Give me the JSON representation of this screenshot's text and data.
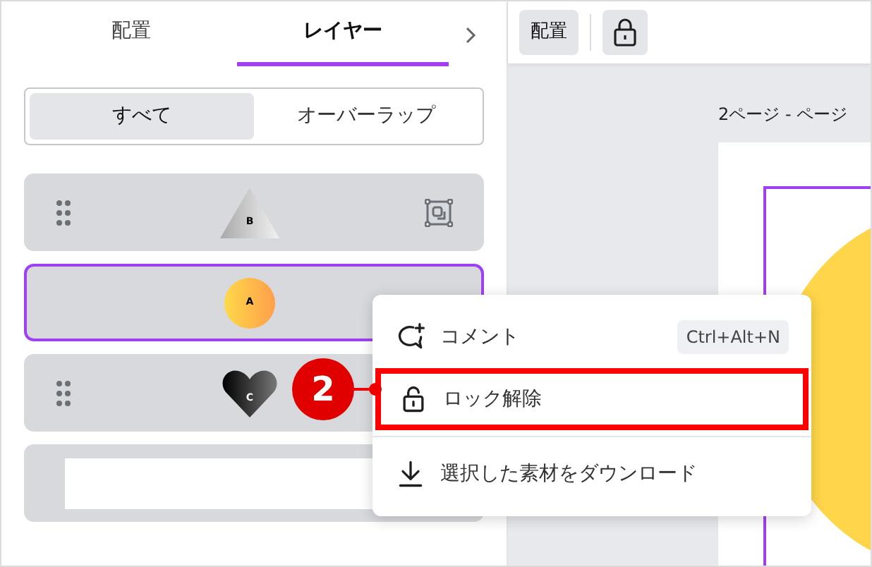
{
  "tabs": [
    {
      "label": "配置",
      "selected": false
    },
    {
      "label": "レイヤー",
      "selected": true
    }
  ],
  "filter": [
    {
      "label": "すべて",
      "selected": true
    },
    {
      "label": "オーバーラップ",
      "selected": false
    }
  ],
  "layers": [
    {
      "kind": "triangle",
      "letter": "B",
      "selected": false,
      "handle": true,
      "frame_icon": true
    },
    {
      "kind": "circle",
      "letter": "A",
      "selected": true,
      "handle": false,
      "frame_icon": false
    },
    {
      "kind": "heart",
      "letter": "C",
      "selected": false,
      "handle": true,
      "frame_icon": false
    },
    {
      "kind": "rect",
      "selected": false,
      "handle": false,
      "frame_icon": false
    }
  ],
  "toolbar": {
    "arrange_label": "配置"
  },
  "canvas": {
    "page_title": "2ページ - ページ"
  },
  "context_menu": [
    {
      "kind": "comment",
      "label": "コメント",
      "shortcut": "Ctrl+Alt+N",
      "highlighted": false
    },
    {
      "kind": "unlock",
      "label": "ロック解除",
      "highlighted": true
    },
    {
      "kind": "download",
      "label": "選択した素材をダウンロード",
      "highlighted": false
    }
  ],
  "callout": {
    "number": "2"
  }
}
